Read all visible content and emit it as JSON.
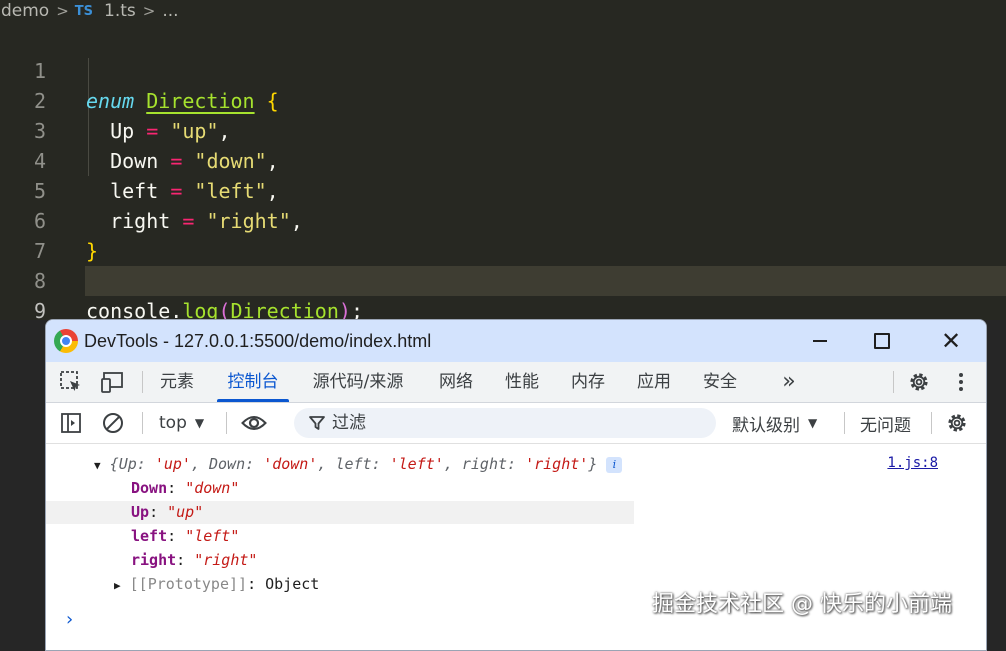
{
  "editor": {
    "breadcrumb": {
      "folder": "demo",
      "file_type_badge": "TS",
      "file": "1.ts",
      "more": "..."
    },
    "line_numbers": [
      "1",
      "2",
      "3",
      "4",
      "5",
      "6",
      "7",
      "8",
      "9"
    ],
    "active_line": "9",
    "code": {
      "l1": {
        "keyword": "enum",
        "name": "Direction",
        "brace": "{"
      },
      "l2": {
        "member": "Up",
        "eq": "=",
        "value": "\"up\"",
        "comma": ","
      },
      "l3": {
        "member": "Down",
        "eq": "=",
        "value": "\"down\"",
        "comma": ","
      },
      "l4": {
        "member": "left",
        "eq": "=",
        "value": "\"left\"",
        "comma": ","
      },
      "l5": {
        "member": "right",
        "eq": "=",
        "value": "\"right\"",
        "comma": ","
      },
      "l6": {
        "brace": "}"
      },
      "l8": {
        "obj": "console",
        "dot": ".",
        "method": "log",
        "open": "(",
        "arg": "Direction",
        "close": ")",
        "semi": ";"
      }
    },
    "colors": {
      "background": "#272822",
      "keyword": "#66d9ef",
      "type": "#a6e22e",
      "string": "#e6db74",
      "operator": "#f92672"
    }
  },
  "devtools": {
    "title": "DevTools - 127.0.0.1:5500/demo/index.html",
    "tabs": [
      "元素",
      "控制台",
      "源代码/来源",
      "网络",
      "性能",
      "内存",
      "应用",
      "安全"
    ],
    "active_tab": "控制台",
    "more_tabs_icon": "»",
    "console_toolbar": {
      "context": "top",
      "filter_placeholder": "过滤",
      "level": "默认级别",
      "issues": "无问题"
    },
    "output": {
      "summary": {
        "open": "{",
        "k1": "Up",
        "v1": "'up'",
        "k2": "Down",
        "v2": "'down'",
        "k3": "left",
        "v3": "'left'",
        "k4": "right",
        "v4": "'right'",
        "close": "}",
        "info": "i"
      },
      "source": "1.js:8",
      "properties": [
        {
          "key": "Down",
          "value": "\"down\""
        },
        {
          "key": "Up",
          "value": "\"up\""
        },
        {
          "key": "left",
          "value": "\"left\""
        },
        {
          "key": "right",
          "value": "\"right\""
        }
      ],
      "prototype": {
        "key": "[[Prototype]]",
        "value": "Object"
      },
      "prompt": "›"
    },
    "colors": {
      "titlebar": "#d3e3fd",
      "accent": "#0b57d0"
    }
  },
  "watermark": "掘金技术社区 @ 快乐的小前端"
}
